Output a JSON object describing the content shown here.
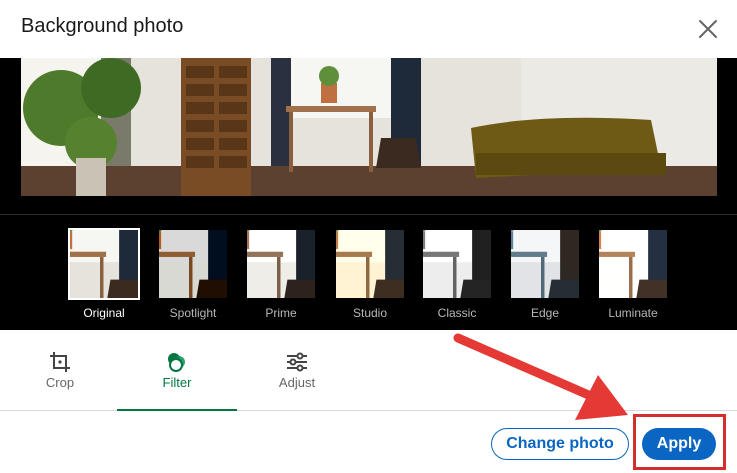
{
  "modal": {
    "title": "Background photo"
  },
  "filters": [
    {
      "label": "Original",
      "selected": true
    },
    {
      "label": "Spotlight",
      "selected": false
    },
    {
      "label": "Prime",
      "selected": false
    },
    {
      "label": "Studio",
      "selected": false
    },
    {
      "label": "Classic",
      "selected": false
    },
    {
      "label": "Edge",
      "selected": false
    },
    {
      "label": "Luminate",
      "selected": false
    }
  ],
  "tabs": [
    {
      "label": "Crop",
      "icon": "crop-icon",
      "active": false
    },
    {
      "label": "Filter",
      "icon": "filter-icon",
      "active": true
    },
    {
      "label": "Adjust",
      "icon": "sliders-icon",
      "active": false
    }
  ],
  "footer": {
    "change_photo_label": "Change photo",
    "apply_label": "Apply"
  },
  "colors": {
    "primary": "#0a66c2",
    "active_tab": "#057642",
    "annotation": "#d32f2f",
    "editor_bg": "#000000"
  }
}
